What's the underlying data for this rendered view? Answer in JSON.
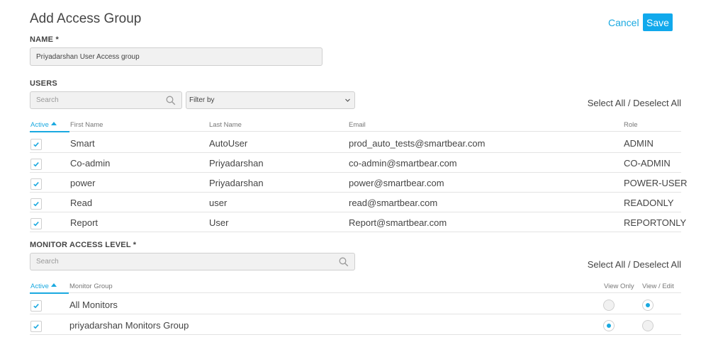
{
  "header": {
    "title": "Add Access Group",
    "cancel_label": "Cancel",
    "save_label": "Save"
  },
  "name_section": {
    "label": "NAME *",
    "value": "Priyadarshan User Access group"
  },
  "users_section": {
    "label": "USERS",
    "search_placeholder": "Search",
    "filter_label": "Filter by",
    "select_all": "Select All",
    "separator": " / ",
    "deselect_all": "Deselect All",
    "columns": {
      "active": "Active",
      "first_name": "First Name",
      "last_name": "Last Name",
      "email": "Email",
      "role": "Role"
    },
    "rows": [
      {
        "active": true,
        "first_name": "Smart",
        "last_name": "AutoUser",
        "email": "prod_auto_tests@smartbear.com",
        "role": "ADMIN"
      },
      {
        "active": true,
        "first_name": "Co-admin",
        "last_name": "Priyadarshan",
        "email": "co-admin@smartbear.com",
        "role": "CO-ADMIN"
      },
      {
        "active": true,
        "first_name": "power",
        "last_name": "Priyadarshan",
        "email": "power@smartbear.com",
        "role": "POWER-USER"
      },
      {
        "active": true,
        "first_name": "Read",
        "last_name": "user",
        "email": "read@smartbear.com",
        "role": "READONLY"
      },
      {
        "active": true,
        "first_name": "Report",
        "last_name": "User",
        "email": "Report@smartbear.com",
        "role": "REPORTONLY"
      }
    ]
  },
  "monitor_section": {
    "label": "MONITOR ACCESS LEVEL *",
    "search_placeholder": "Search",
    "select_all": "Select All",
    "separator": " / ",
    "deselect_all": "Deselect All",
    "columns": {
      "active": "Active",
      "monitor_group": "Monitor Group",
      "view_only": "View Only",
      "view_edit": "View / Edit"
    },
    "rows": [
      {
        "active": true,
        "group": "All Monitors",
        "access": "view_edit"
      },
      {
        "active": true,
        "group": "priyadarshan Monitors Group",
        "access": "view_only"
      }
    ]
  },
  "colors": {
    "accent": "#1aa9e0",
    "save_button": "#11a9ec"
  }
}
